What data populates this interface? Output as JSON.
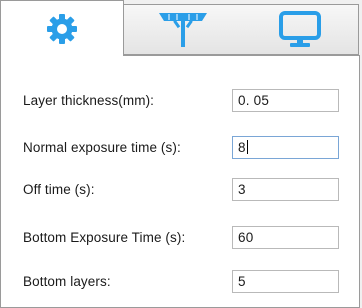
{
  "tabs": [
    {
      "icon": "gear-icon",
      "active": true
    },
    {
      "icon": "build-platform-icon",
      "active": false
    },
    {
      "icon": "monitor-icon",
      "active": false
    }
  ],
  "colors": {
    "icon_blue": "#2a9ee8",
    "panel_bg": "#ffffff",
    "window_bg": "#f0f0f0",
    "focus_border": "#7aa6d6"
  },
  "settings": {
    "layer_thickness": {
      "label": "Layer thickness(mm):",
      "value": "0. 05"
    },
    "normal_exposure": {
      "label": "Normal exposure time (s):",
      "value": "8"
    },
    "off_time": {
      "label": "Off time (s):",
      "value": "3"
    },
    "bottom_exposure": {
      "label": "Bottom Exposure Time (s):",
      "value": "60"
    },
    "bottom_layers": {
      "label": "Bottom layers:",
      "value": "5"
    }
  }
}
